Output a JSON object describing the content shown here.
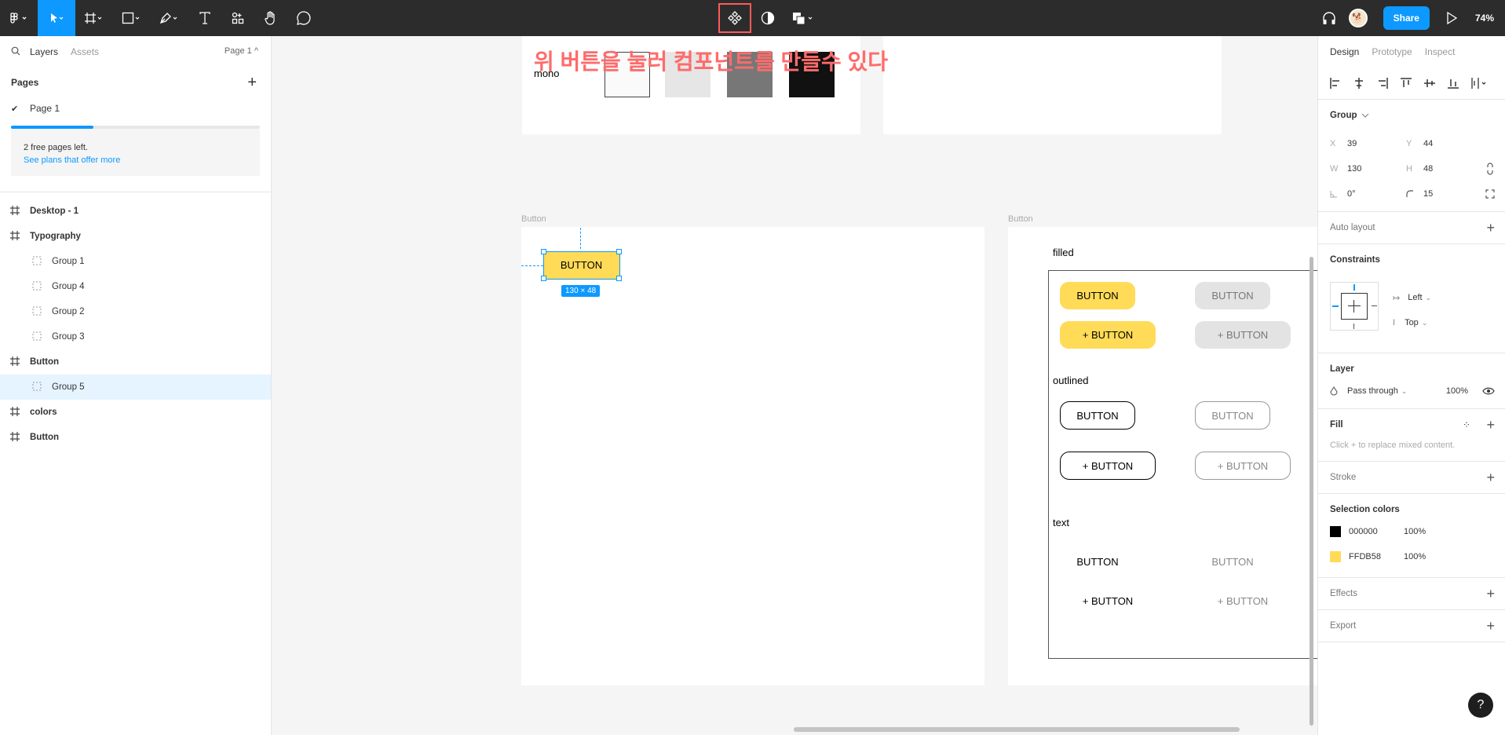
{
  "toolbar": {
    "share_label": "Share",
    "zoom": "74%",
    "avatar_glyph": "🐕",
    "icons": [
      "figma-menu-icon",
      "move-tool-icon",
      "frame-tool-icon",
      "shape-tool-icon",
      "pen-tool-icon",
      "text-tool-icon",
      "resources-icon",
      "hand-tool-icon",
      "comment-icon",
      "create-component-icon",
      "mask-icon",
      "boolean-icon",
      "headphones-icon",
      "play-icon"
    ]
  },
  "left_panel": {
    "tab_layers": "Layers",
    "tab_assets": "Assets",
    "page_selector": "Page 1 ^",
    "pages_header": "Pages",
    "add_page": "+",
    "current_page": "Page 1",
    "current_page_check": "✔",
    "free_pages_text": "2 free pages left.",
    "free_pages_link": "See plans that offer more",
    "free_pages_progress": 0.33,
    "layers": [
      {
        "label": "Desktop - 1",
        "type": "frame"
      },
      {
        "label": "Typography",
        "type": "frame"
      },
      {
        "label": "Group 1",
        "type": "group"
      },
      {
        "label": "Group 4",
        "type": "group"
      },
      {
        "label": "Group 2",
        "type": "group"
      },
      {
        "label": "Group 3",
        "type": "group"
      },
      {
        "label": "Button",
        "type": "frame"
      },
      {
        "label": "Group 5",
        "type": "group",
        "selected": true
      },
      {
        "label": "colors",
        "type": "frame"
      },
      {
        "label": "Button",
        "type": "frame"
      }
    ]
  },
  "canvas": {
    "annotation": "위 버튼을 눌러 컴포넌트를 만들수 있다",
    "annotation_color": "#ff6b6b",
    "mono_label": "mono",
    "frame_label_left": "Button",
    "frame_label_right": "Button",
    "selected_button_label": "BUTTON",
    "selected_dimensions": "130 × 48",
    "section_filled": "filled",
    "section_outlined": "outlined",
    "section_text": "text",
    "btn_label": "BUTTON",
    "btn_plus_label": "+ BUTTON",
    "accent_yellow": "#FFDB58",
    "selection_blue": "#0d99ff"
  },
  "right_panel": {
    "tab_design": "Design",
    "tab_prototype": "Prototype",
    "tab_inspect": "Inspect",
    "group_label": "Group",
    "x_label": "X",
    "x_value": "39",
    "y_label": "Y",
    "y_value": "44",
    "w_label": "W",
    "w_value": "130",
    "h_label": "H",
    "h_value": "48",
    "rotation": "0°",
    "radius": "15",
    "auto_layout": "Auto layout",
    "constraints": "Constraints",
    "constraint_h": "Left",
    "constraint_v": "Top",
    "layer_header": "Layer",
    "blend_mode": "Pass through",
    "opacity": "100%",
    "fill_header": "Fill",
    "fill_hint": "Click + to replace mixed content.",
    "stroke_header": "Stroke",
    "selection_colors": "Selection colors",
    "colors": [
      {
        "hex": "000000",
        "opacity": "100%",
        "swatch": "#000000"
      },
      {
        "hex": "FFDB58",
        "opacity": "100%",
        "swatch": "#FFDB58"
      }
    ],
    "effects_header": "Effects",
    "export_header": "Export",
    "help": "?"
  }
}
